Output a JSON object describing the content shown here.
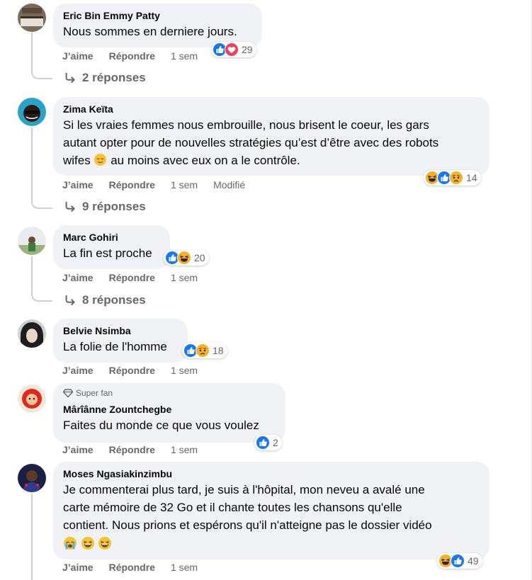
{
  "actions": {
    "like": "J’aime",
    "reply": "Répondre",
    "edited": "Modifié"
  },
  "comments": [
    {
      "author": "Eric Bin Emmy Patty",
      "text": "Nous sommes en derniere jours.",
      "time": "1 sem",
      "reactions": [
        "like-icon",
        "love-icon"
      ],
      "reaction_count": "29",
      "replies": "2 réponses"
    },
    {
      "author": "Zima Keïta",
      "text": [
        "Si les vraies femmes nous embrouille, nous brisent le coeur, les gars",
        "autant opter pour de nouvelles stratégies qu’est d’être avec des robots",
        "wifes",
        "au moins avec eux on a le contrôle."
      ],
      "emoji": [
        "relieved-face"
      ],
      "time": "1 sem",
      "reactions": [
        "haha-icon",
        "like-icon",
        "sad-icon"
      ],
      "reaction_count": "14",
      "replies": "9 réponses"
    },
    {
      "author": "Marc Gohiri",
      "text": "La fin est proche",
      "time": "1 sem",
      "reactions": [
        "like-icon",
        "haha-icon"
      ],
      "reaction_count": "20",
      "replies": "8 réponses"
    },
    {
      "author": "Belvie Nsimba",
      "text": "La folie de l'homme",
      "time": "1 sem",
      "reactions": [
        "like-icon",
        "sad-icon"
      ],
      "reaction_count": "18"
    },
    {
      "badge": "Super fan",
      "author": "Mârîânne Zountchegbe",
      "text": "Faites du monde ce que vous voulez",
      "time": "1 sem",
      "reactions": [
        "like-icon"
      ],
      "reaction_count": "2"
    },
    {
      "author": "Moses Ngasiakinzimbu",
      "text": [
        "Je commenterai plus tard, je suis à l'hôpital, mon neveu a avalé une",
        "carte mémoire de 32 Go et il chante toutes les chansons qu'elle",
        "contient. Nous prions et espérons qu'il n'atteigne pas le dossier vidéo"
      ],
      "emoji": [
        "crying-face",
        "laughing-face",
        "laughing-face"
      ],
      "time": "1 sem",
      "reactions": [
        "haha-icon",
        "like-icon"
      ],
      "reaction_count": "49"
    }
  ],
  "colors": {
    "like": "#1877f2",
    "love": "#f33e58",
    "haha": "#f7b125",
    "bubble": "#f0f2f5",
    "meta": "#65676b"
  }
}
